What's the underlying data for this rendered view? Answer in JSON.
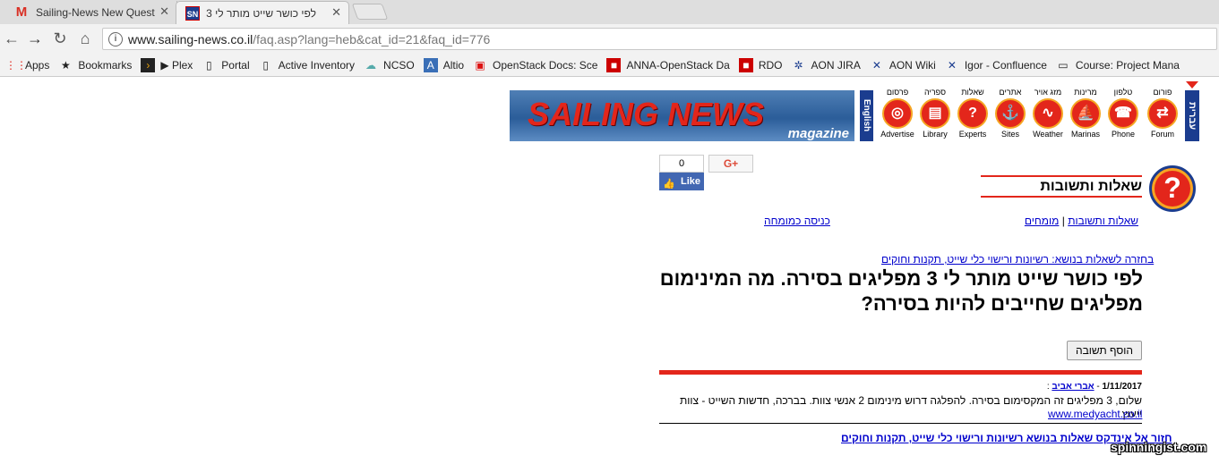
{
  "browser": {
    "tabs": [
      {
        "title": "Sailing-News New Quest",
        "icon": "gmail-icon"
      },
      {
        "title": "לפי כושר שייט מותר לי 3",
        "icon": "sailing-news-icon"
      }
    ],
    "url": {
      "host": "www.sailing-news.co.il",
      "path": "/faq.asp?lang=heb&cat_id=21&faq_id=776"
    },
    "bookmarks": [
      "Apps",
      "Bookmarks",
      "▶ Plex",
      "Portal",
      "Active Inventory",
      "NCSO",
      "Altio",
      "OpenStack Docs: Sce",
      "ANNA-OpenStack Da",
      "RDO",
      "AON JIRA",
      "AON Wiki",
      "Igor - Confluence",
      "Course: Project Mana"
    ]
  },
  "site": {
    "banner_title": "SAILING NEWS",
    "banner_sub": "magazine",
    "english_tab": "English",
    "hebrew_tab": "עברית",
    "nav": [
      {
        "heb": "פורום",
        "en": "Forum"
      },
      {
        "heb": "טלפון",
        "en": "Phone"
      },
      {
        "heb": "מרינות",
        "en": "Marinas"
      },
      {
        "heb": "מזג אויר",
        "en": "Weather"
      },
      {
        "heb": "אתרים",
        "en": "Sites"
      },
      {
        "heb": "שאלות",
        "en": "Experts"
      },
      {
        "heb": "ספריה",
        "en": "Library"
      },
      {
        "heb": "פרסום",
        "en": "Advertise"
      }
    ]
  },
  "social": {
    "fb_count": "0",
    "fb_like": "Like",
    "gplus": "G+"
  },
  "section": {
    "title": "שאלות ותשובות",
    "crumb_faq": "שאלות ותשובות",
    "crumb_sep": "|",
    "crumb_experts": "מומחים",
    "expert_login": "כניסה כמומחה",
    "back_link": "בחזרה לשאלות בנושא: רשיונות ורישוי כלי שייט, תקנות וחוקים"
  },
  "question": {
    "title": "לפי כושר שייט מותר לי 3 מפליגים בסירה. מה המינימום מפליגים שחייבים להיות בסירה?",
    "add_answer": "הוסף תשובה"
  },
  "answer": {
    "date": "1/11/2017",
    "dash": " - ",
    "author": "אברי אביב",
    "colon": " :",
    "text": "שלום, 3 מפליגים זה המקסימום בסירה. להפלגה דרוש מינימום 2 אנשי צוות. בברכה, חדשות השייט - צוות ייעוץ",
    "url": "www.medyacht.co.il"
  },
  "bottom_link": "חזור אל אינדקס שאלות בנושא רשיונות ורישוי כלי שייט, תקנות וחוקים",
  "watermark": "spinningist.com"
}
